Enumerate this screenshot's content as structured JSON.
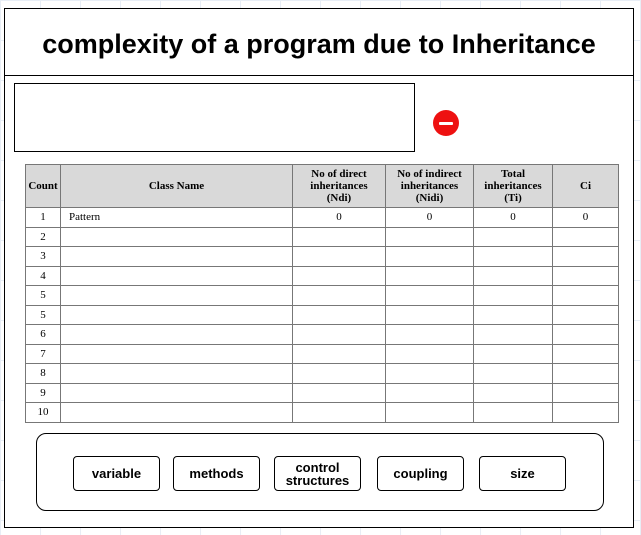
{
  "header": {
    "title": "complexity of a program due to Inheritance"
  },
  "input": {
    "value": ""
  },
  "table": {
    "columns": [
      "Count",
      "Class Name",
      "No of direct inheritances (Ndi)",
      "No of indirect inheritances (Nidi)",
      "Total inheritances (Ti)",
      "Ci"
    ],
    "column_lines": [
      [
        "Count"
      ],
      [
        "Class Name"
      ],
      [
        "No of direct",
        "inheritances",
        "(Ndi)"
      ],
      [
        "No of indirect",
        "inheritances",
        "(Nidi)"
      ],
      [
        "Total",
        "inheritances",
        "(Ti)"
      ],
      [
        "Ci"
      ]
    ],
    "rows": [
      [
        "1",
        "Pattern",
        "0",
        "0",
        "0",
        "0"
      ],
      [
        "2",
        "",
        "",
        "",
        "",
        ""
      ],
      [
        "3",
        "",
        "",
        "",
        "",
        ""
      ],
      [
        "4",
        "",
        "",
        "",
        "",
        ""
      ],
      [
        "5",
        "",
        "",
        "",
        "",
        ""
      ],
      [
        "5",
        "",
        "",
        "",
        "",
        ""
      ],
      [
        "6",
        "",
        "",
        "",
        "",
        ""
      ],
      [
        "7",
        "",
        "",
        "",
        "",
        ""
      ],
      [
        "8",
        "",
        "",
        "",
        "",
        ""
      ],
      [
        "9",
        "",
        "",
        "",
        "",
        ""
      ],
      [
        "10",
        "",
        "",
        "",
        "",
        ""
      ]
    ]
  },
  "buttons": [
    {
      "name": "variable-button",
      "label": "variable",
      "lines": [
        "variable"
      ]
    },
    {
      "name": "methods-button",
      "label": "methods",
      "lines": [
        "methods"
      ]
    },
    {
      "name": "control-structures-button",
      "label": "control structures",
      "lines": [
        "control",
        "structures"
      ]
    },
    {
      "name": "coupling-button",
      "label": "coupling",
      "lines": [
        "coupling"
      ]
    },
    {
      "name": "size-button",
      "label": "size",
      "lines": [
        "size"
      ]
    }
  ],
  "colors": {
    "remove_button": "#ee1111",
    "header_fill": "#d9d9d9"
  },
  "icons": {
    "remove": "minus-circle-icon"
  }
}
